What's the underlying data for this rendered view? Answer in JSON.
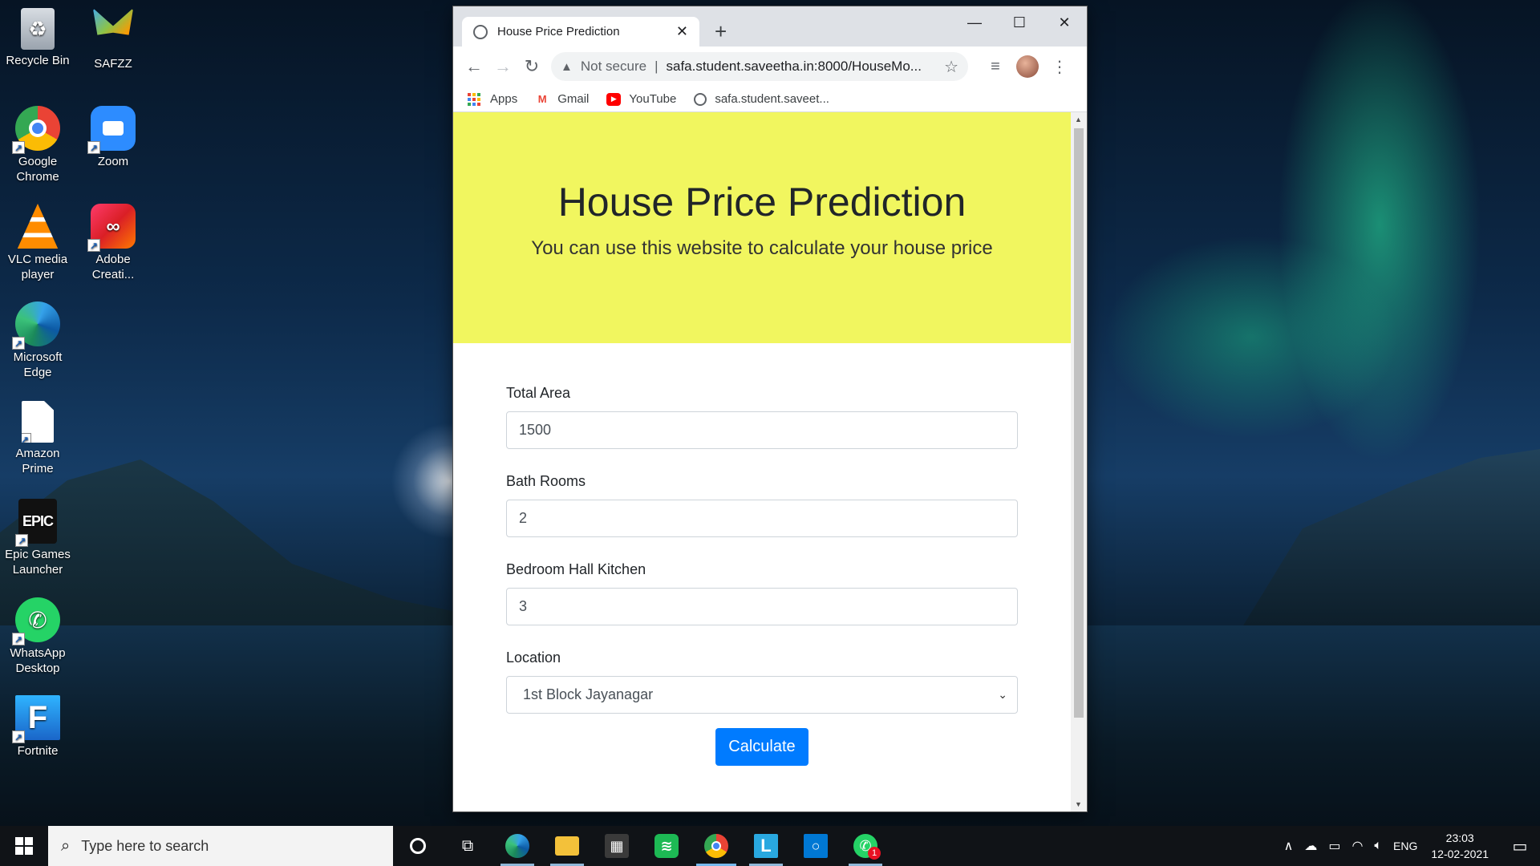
{
  "desktop": {
    "icons": [
      {
        "label": "Recycle Bin",
        "icon": "recycle-bin-icon"
      },
      {
        "label": "SAFZZ",
        "icon": "safzz-butterfly-icon"
      },
      {
        "label": "Google Chrome",
        "icon": "chrome-icon"
      },
      {
        "label": "Zoom",
        "icon": "zoom-icon"
      },
      {
        "label": "VLC media player",
        "icon": "vlc-icon"
      },
      {
        "label": "Adobe Creati...",
        "icon": "adobe-cc-icon"
      },
      {
        "label": "Microsoft Edge",
        "icon": "edge-icon"
      },
      {
        "label": "Amazon Prime",
        "icon": "file-icon"
      },
      {
        "label": "Epic Games Launcher",
        "icon": "epic-games-icon"
      },
      {
        "label": "WhatsApp Desktop",
        "icon": "whatsapp-icon"
      },
      {
        "label": "Fortnite",
        "icon": "fortnite-icon"
      }
    ]
  },
  "browser": {
    "tab_title": "House Price Prediction",
    "tab_close": "✕",
    "new_tab": "+",
    "win_min": "—",
    "win_max": "☐",
    "win_close": "✕",
    "security_label": "Not secure",
    "url": "safa.student.saveetha.in:8000/HouseMo...",
    "bookmarks": [
      {
        "label": "Apps",
        "icon": "apps-grid-icon"
      },
      {
        "label": "Gmail",
        "icon": "gmail-icon"
      },
      {
        "label": "YouTube",
        "icon": "youtube-icon"
      },
      {
        "label": "safa.student.saveet...",
        "icon": "globe-icon"
      }
    ]
  },
  "page": {
    "heading": "House Price Prediction",
    "subheading": "You can use this website to calculate your house price",
    "fields": {
      "total_area": {
        "label": "Total Area",
        "value": "1500"
      },
      "bath_rooms": {
        "label": "Bath Rooms",
        "value": "2"
      },
      "bhk": {
        "label": "Bedroom Hall Kitchen",
        "value": "3"
      },
      "location": {
        "label": "Location",
        "value": "1st Block Jayanagar"
      }
    },
    "calculate_label": "Calculate",
    "colors": {
      "jumbotron": "#f1f65f",
      "button": "#007bff"
    }
  },
  "taskbar": {
    "search_placeholder": "Type here to search",
    "language": "ENG",
    "time": "23:03",
    "date": "12-02-2021",
    "whatsapp_badge": "1"
  }
}
